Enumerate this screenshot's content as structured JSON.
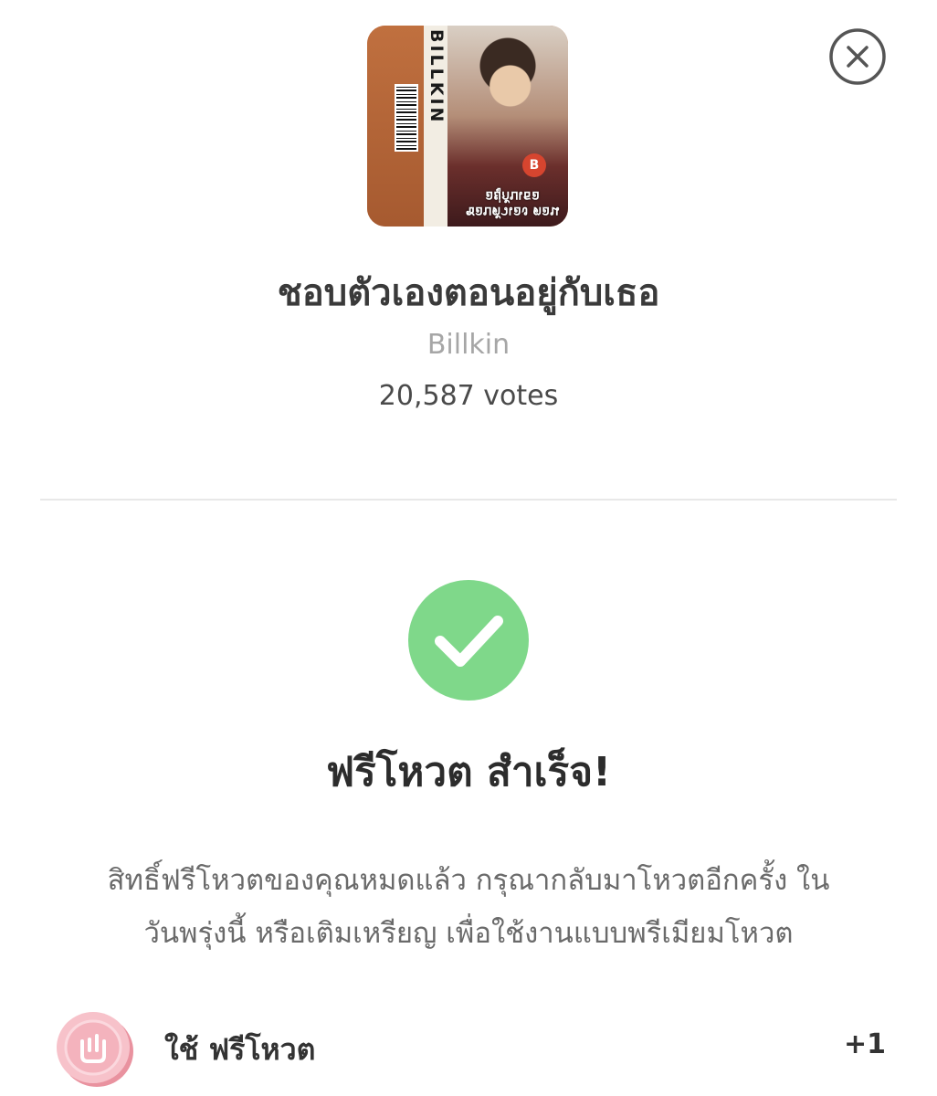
{
  "song": {
    "title": "ชอบตัวเองตอนอยู่กับเธอ",
    "artist": "Billkin",
    "votes": "20,587 votes",
    "cover": {
      "spine_text": "BILLKIN",
      "title_text": "ชอบตัวเอง ตอนอยู่กับเธอ",
      "badge": "B"
    }
  },
  "close": {
    "icon": "close-icon"
  },
  "result": {
    "icon": "check-circle-icon",
    "title": "ฟรีโหวต สำเร็จ!",
    "message_line1": "สิทธิ์ฟรีโหวตของคุณหมดแล้ว กรุณากลับมาโหวตอีกครั้ง ใน",
    "message_line2": "วันพรุ่งนี้ หรือเติมเหรียญ เพื่อใช้งานแบบพรีเมียมโหวต"
  },
  "free_vote": {
    "icon": "vote-coin-icon",
    "label": "ใช้  ฟรีโหวต",
    "count": "+1"
  },
  "colors": {
    "success_green": "#7fd88a",
    "coin_pink": "#f4b3bd",
    "divider": "#e8e8e8"
  }
}
